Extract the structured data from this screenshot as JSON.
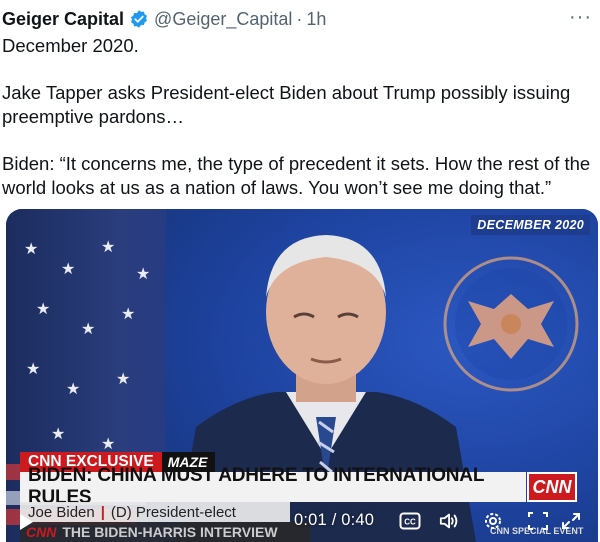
{
  "tweet": {
    "author_name": "Geiger Capital",
    "handle": "@Geiger_Capital",
    "separator": "·",
    "time": "1h",
    "more_label": "···",
    "text": {
      "line1": "December 2020.",
      "line2": "Jake Tapper asks President-elect Biden about Trump possibly issuing preemptive pardons…",
      "line3": "Biden: “It concerns me, the type of precedent it sets. How the rest of the world looks at us as a nation of laws. You won’t see me doing that.”"
    }
  },
  "video": {
    "date_tag": "DECEMBER 2020",
    "exclusive_label": "CNN EXCLUSIVE",
    "segment_label": "MAZE",
    "headline": "BIDEN: CHINA MUST ADHERE TO INTERNATIONAL RULES",
    "network_logo": "CNN",
    "name_label": "Joe Biden",
    "name_sep": "|",
    "name_title": "(D) President-elect",
    "show_network": "CNN",
    "show_title": "THE BIDEN-HARRIS INTERVIEW",
    "special_event": "CNN SPECIAL EVENT",
    "time_readout": "0:01 / 0:40",
    "cc_label": "CC"
  },
  "colors": {
    "verified_blue": "#1d9bf0",
    "cnn_red": "#cc1a1f",
    "muted_text": "#536471"
  }
}
